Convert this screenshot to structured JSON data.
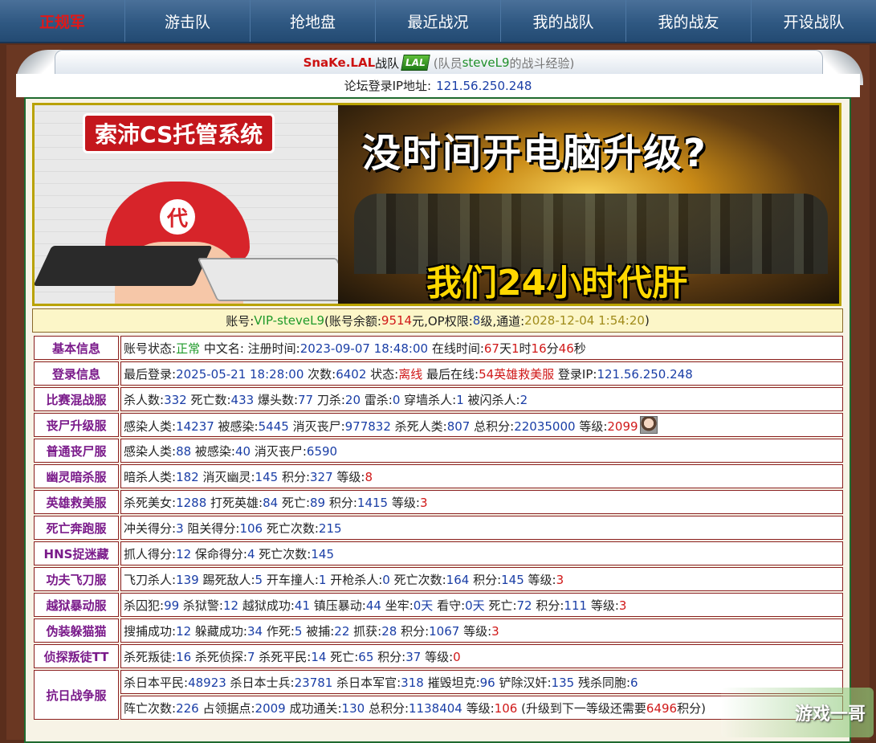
{
  "nav": [
    "正规军",
    "游击队",
    "抢地盘",
    "最近战况",
    "我的战队",
    "我的战友",
    "开设战队"
  ],
  "header": {
    "team": "SnaKe.LAL",
    "team_suffix": "战队",
    "badge": "LAL",
    "paren_open": "(队员",
    "player": "steveL9",
    "paren_close": "的战斗经验)"
  },
  "ip_bar": {
    "label": "论坛登录IP地址:",
    "value": "121.56.250.248"
  },
  "banner": {
    "left_title": "索沛CS托管系统",
    "hat_char": "代",
    "question": "没时间开电脑升级?",
    "slogan": "我们24小时代肝"
  },
  "account": {
    "p1": "账号:",
    "id": "VIP-steveL9",
    "p2": "(账号余额:",
    "balance": "9514",
    "p3": "元,OP权限:",
    "op": "8",
    "p4": "级,通道:",
    "channel": "2028-12-04 1:54:20",
    "p5": ")"
  },
  "rows": [
    {
      "label": "基本信息",
      "line1": [
        [
          "k",
          "账号状态:"
        ],
        [
          "g",
          "正常"
        ],
        [
          "k",
          " 中文名: 注册时间:"
        ],
        [
          "n",
          "2023-09-07 18:48:00"
        ],
        [
          "k",
          " 在线时间:"
        ],
        [
          "r",
          "67"
        ],
        [
          "k",
          "天"
        ],
        [
          "r",
          "1"
        ],
        [
          "k",
          "时"
        ],
        [
          "r",
          "16"
        ],
        [
          "k",
          "分"
        ],
        [
          "r",
          "46"
        ],
        [
          "k",
          "秒"
        ]
      ]
    },
    {
      "label": "登录信息",
      "line1": [
        [
          "k",
          "最后登录:"
        ],
        [
          "n",
          "2025-05-21 18:28:00"
        ],
        [
          "k",
          " 次数:"
        ],
        [
          "n",
          "6402"
        ],
        [
          "k",
          " 状态:"
        ],
        [
          "r",
          "离线"
        ],
        [
          "k",
          " 最后在线:"
        ],
        [
          "r",
          "54英雄救美服"
        ],
        [
          "k",
          " 登录IP:"
        ],
        [
          "n",
          "121.56.250.248"
        ]
      ]
    },
    {
      "label": "比赛混战服",
      "line1": [
        [
          "k",
          "杀人数:"
        ],
        [
          "n",
          "332"
        ],
        [
          "k",
          " 死亡数:"
        ],
        [
          "n",
          "433"
        ],
        [
          "k",
          " 爆头数:"
        ],
        [
          "n",
          "77"
        ],
        [
          "k",
          " 刀杀:"
        ],
        [
          "n",
          "20"
        ],
        [
          "k",
          " 雷杀:"
        ],
        [
          "n",
          "0"
        ],
        [
          "k",
          " 穿墙杀人:"
        ],
        [
          "n",
          "1"
        ],
        [
          "k",
          " 被闪杀人:"
        ],
        [
          "n",
          "2"
        ]
      ]
    },
    {
      "label": "丧尸升级服",
      "avatar": true,
      "line1": [
        [
          "k",
          "感染人类:"
        ],
        [
          "n",
          "14237"
        ],
        [
          "k",
          " 被感染:"
        ],
        [
          "n",
          "5445"
        ],
        [
          "k",
          " 消灭丧尸:"
        ],
        [
          "n",
          "977832"
        ],
        [
          "k",
          " 杀死人类:"
        ],
        [
          "n",
          "807"
        ],
        [
          "k",
          " 总积分:"
        ],
        [
          "n",
          "22035000"
        ],
        [
          "k",
          " 等级:"
        ],
        [
          "r",
          "2099"
        ]
      ]
    },
    {
      "label": "普通丧尸服",
      "line1": [
        [
          "k",
          "感染人类:"
        ],
        [
          "n",
          "88"
        ],
        [
          "k",
          " 被感染:"
        ],
        [
          "n",
          "40"
        ],
        [
          "k",
          " 消灭丧尸:"
        ],
        [
          "n",
          "6590"
        ]
      ]
    },
    {
      "label": "幽灵暗杀服",
      "line1": [
        [
          "k",
          "暗杀人类:"
        ],
        [
          "n",
          "182"
        ],
        [
          "k",
          " 消灭幽灵:"
        ],
        [
          "n",
          "145"
        ],
        [
          "k",
          " 积分:"
        ],
        [
          "n",
          "327"
        ],
        [
          "k",
          " 等级:"
        ],
        [
          "r",
          "8"
        ]
      ]
    },
    {
      "label": "英雄救美服",
      "line1": [
        [
          "k",
          "杀死美女:"
        ],
        [
          "n",
          "1288"
        ],
        [
          "k",
          " 打死英雄:"
        ],
        [
          "n",
          "84"
        ],
        [
          "k",
          " 死亡:"
        ],
        [
          "n",
          "89"
        ],
        [
          "k",
          " 积分:"
        ],
        [
          "n",
          "1415"
        ],
        [
          "k",
          " 等级:"
        ],
        [
          "r",
          "3"
        ]
      ]
    },
    {
      "label": "死亡奔跑服",
      "line1": [
        [
          "k",
          "冲关得分:"
        ],
        [
          "n",
          "3"
        ],
        [
          "k",
          " 阻关得分:"
        ],
        [
          "n",
          "106"
        ],
        [
          "k",
          " 死亡次数:"
        ],
        [
          "n",
          "215"
        ]
      ]
    },
    {
      "label": "HNS捉迷藏",
      "line1": [
        [
          "k",
          "抓人得分:"
        ],
        [
          "n",
          "12"
        ],
        [
          "k",
          " 保命得分:"
        ],
        [
          "n",
          "4"
        ],
        [
          "k",
          " 死亡次数:"
        ],
        [
          "n",
          "145"
        ]
      ]
    },
    {
      "label": "功夫飞刀服",
      "line1": [
        [
          "k",
          "飞刀杀人:"
        ],
        [
          "n",
          "139"
        ],
        [
          "k",
          " 踢死敌人:"
        ],
        [
          "n",
          "5"
        ],
        [
          "k",
          " 开车撞人:"
        ],
        [
          "n",
          "1"
        ],
        [
          "k",
          " 开枪杀人:"
        ],
        [
          "n",
          "0"
        ],
        [
          "k",
          " 死亡次数:"
        ],
        [
          "n",
          "164"
        ],
        [
          "k",
          " 积分:"
        ],
        [
          "n",
          "145"
        ],
        [
          "k",
          " 等级:"
        ],
        [
          "r",
          "3"
        ]
      ]
    },
    {
      "label": "越狱暴动服",
      "line1": [
        [
          "k",
          "杀囚犯:"
        ],
        [
          "n",
          "99"
        ],
        [
          "k",
          " 杀狱警:"
        ],
        [
          "n",
          "12"
        ],
        [
          "k",
          " 越狱成功:"
        ],
        [
          "n",
          "41"
        ],
        [
          "k",
          " 镇压暴动:"
        ],
        [
          "n",
          "44"
        ],
        [
          "k",
          " 坐牢:"
        ],
        [
          "n",
          "0天"
        ],
        [
          "k",
          " 看守:"
        ],
        [
          "n",
          "0天"
        ],
        [
          "k",
          " 死亡:"
        ],
        [
          "n",
          "72"
        ],
        [
          "k",
          " 积分:"
        ],
        [
          "n",
          "111"
        ],
        [
          "k",
          " 等级:"
        ],
        [
          "r",
          "3"
        ]
      ]
    },
    {
      "label": "伪装躲猫猫",
      "line1": [
        [
          "k",
          "搜捕成功:"
        ],
        [
          "n",
          "12"
        ],
        [
          "k",
          " 躲藏成功:"
        ],
        [
          "n",
          "34"
        ],
        [
          "k",
          " 作死:"
        ],
        [
          "n",
          "5"
        ],
        [
          "k",
          " 被捕:"
        ],
        [
          "n",
          "22"
        ],
        [
          "k",
          " 抓获:"
        ],
        [
          "n",
          "28"
        ],
        [
          "k",
          " 积分:"
        ],
        [
          "n",
          "1067"
        ],
        [
          "k",
          " 等级:"
        ],
        [
          "r",
          "3"
        ]
      ]
    },
    {
      "label": "侦探叛徒TT",
      "line1": [
        [
          "k",
          "杀死叛徒:"
        ],
        [
          "n",
          "16"
        ],
        [
          "k",
          " 杀死侦探:"
        ],
        [
          "n",
          "7"
        ],
        [
          "k",
          " 杀死平民:"
        ],
        [
          "n",
          "14"
        ],
        [
          "k",
          " 死亡:"
        ],
        [
          "n",
          "65"
        ],
        [
          "k",
          " 积分:"
        ],
        [
          "n",
          "37"
        ],
        [
          "k",
          " 等级:"
        ],
        [
          "r",
          "0"
        ]
      ]
    },
    {
      "label": "抗日战争服",
      "line1": [
        [
          "k",
          "杀日本平民:"
        ],
        [
          "n",
          "48923"
        ],
        [
          "k",
          " 杀日本士兵:"
        ],
        [
          "n",
          "23781"
        ],
        [
          "k",
          " 杀日本军官:"
        ],
        [
          "n",
          "318"
        ],
        [
          "k",
          " 摧毁坦克:"
        ],
        [
          "n",
          "96"
        ],
        [
          "k",
          " 铲除汉奸:"
        ],
        [
          "n",
          "135"
        ],
        [
          "k",
          " 残杀同胞:"
        ],
        [
          "n",
          "6"
        ]
      ],
      "line2": [
        [
          "k",
          "阵亡次数:"
        ],
        [
          "n",
          "226"
        ],
        [
          "k",
          " 占领据点:"
        ],
        [
          "n",
          "2009"
        ],
        [
          "k",
          " 成功通关:"
        ],
        [
          "n",
          "130"
        ],
        [
          "k",
          " 总积分:"
        ],
        [
          "n",
          "1138404"
        ],
        [
          "k",
          " 等级:"
        ],
        [
          "r",
          "106"
        ],
        [
          "k",
          " (升级到下一等级还需要"
        ],
        [
          "r",
          "6496"
        ],
        [
          "k",
          "积分)"
        ]
      ]
    }
  ],
  "watermark": "游戏一哥"
}
